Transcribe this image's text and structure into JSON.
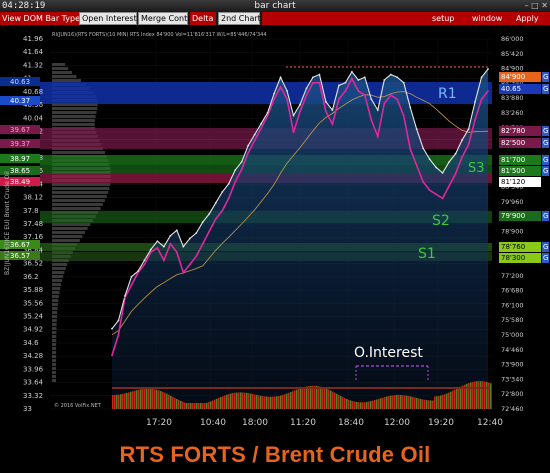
{
  "window": {
    "time": "04:28:19",
    "title": "bar chart",
    "controls": "– □ ✕"
  },
  "toolbar": {
    "view_dom": "View DOM",
    "bar_type": "Bar Type",
    "open_interest": "Open Interest",
    "merge_contr": "Merge Contr",
    "delta": "Delta",
    "second_chart": "2nd Chart",
    "setup": "setup",
    "window": "window",
    "apply": "Apply"
  },
  "chart": {
    "info_line": "RI(JUN16)(RTS FORTS)(10 MIN) RTS Index  84'900  Vol=11'816'317  W/L=85'446/74'344",
    "left_axis_title": "BZ(JUN16)(ICE EU) Brent Crude Oil",
    "copyright": "© 2016 VolFix.NET",
    "annotation_oi": "O.Interest",
    "levels": [
      {
        "name": "R1",
        "left_tag": "40.63",
        "left_tag2": "40.37",
        "right_tag": "84'900",
        "right_tag2": "40.65"
      },
      {
        "name": "",
        "left_tag": "39.67",
        "right_tag": "82'780"
      },
      {
        "name": "",
        "left_tag": "39.37",
        "right_tag": "82'500"
      },
      {
        "name": "S3",
        "left_tag": "38.97",
        "left_tag2": "38.65",
        "left_tag3": "38.49",
        "right_tag": "81'700",
        "right_tag2": "81'500",
        "right_tag3": "81'120"
      },
      {
        "name": "S2",
        "right_tag": "79'900"
      },
      {
        "name": "S1",
        "left_tag": "36.67",
        "left_tag2": "36.57",
        "right_tag": "78'760",
        "right_tag2": "78'300"
      }
    ],
    "g_marker": "G"
  },
  "chart_data": {
    "type": "line",
    "left_axis_ticks": [
      "41.96",
      "41.64",
      "41.32",
      "41",
      "40.68",
      "40.36",
      "40.04",
      "39.72",
      "39.4",
      "39.08",
      "38.76",
      "38.44",
      "38.12",
      "37.8",
      "37.48",
      "37.16",
      "36.84",
      "36.52",
      "36.2",
      "35.88",
      "35.56",
      "35.24",
      "34.92",
      "34.6",
      "34.28",
      "33.96",
      "33.64",
      "33.32",
      "33"
    ],
    "right_axis_ticks": [
      "86'000",
      "85'420",
      "84'900",
      "84'340",
      "83'880",
      "83'260",
      "82'780",
      "82'180",
      "81'700",
      "81'120",
      "80'540",
      "79'960",
      "79'440",
      "78'900",
      "78'300",
      "77'760",
      "77'200",
      "76'680",
      "76'100",
      "75'580",
      "75'000",
      "74'460",
      "73'900",
      "73'340",
      "72'800",
      "72'460"
    ],
    "x_ticks": [
      "17:20",
      "10:40",
      "18:00",
      "11:20",
      "18:40",
      "12:00",
      "19:20",
      "12:40"
    ],
    "series": [
      {
        "name": "RTS Index",
        "color": "#e6e6e6",
        "values": [
          75400,
          75700,
          76600,
          77300,
          77500,
          77900,
          78300,
          78600,
          78400,
          78800,
          79000,
          78400,
          78700,
          78900,
          79300,
          79600,
          80000,
          80400,
          80700,
          81200,
          81500,
          82100,
          82500,
          82900,
          83300,
          84000,
          84600,
          84100,
          83200,
          83600,
          84200,
          84600,
          84700,
          83700,
          83400,
          84300,
          84400,
          84800,
          84500,
          84600,
          83800,
          83400,
          84500,
          84700,
          84600,
          84400,
          83500,
          82700,
          82000,
          81600,
          81300,
          81100,
          81500,
          81800,
          82300,
          82700,
          83700,
          84600,
          84900
        ]
      },
      {
        "name": "Brent Crude Oil",
        "color": "#e0279c",
        "values": [
          34.3,
          34.8,
          35.7,
          36.0,
          36.3,
          36.5,
          36.8,
          36.9,
          36.6,
          37.0,
          36.8,
          36.3,
          36.5,
          36.7,
          37.0,
          37.3,
          37.6,
          37.8,
          38.1,
          38.5,
          38.8,
          39.2,
          39.5,
          39.8,
          40.1,
          40.5,
          40.8,
          40.5,
          39.7,
          40.2,
          40.6,
          40.9,
          40.9,
          40.2,
          39.9,
          40.5,
          40.7,
          41.0,
          40.7,
          40.6,
          40.0,
          39.6,
          40.4,
          40.6,
          40.5,
          40.1,
          39.3,
          38.9,
          38.5,
          38.3,
          38.2,
          38.1,
          38.4,
          38.7,
          39.1,
          39.4,
          40.0,
          40.5,
          40.7
        ]
      }
    ],
    "ylim_left": [
      33,
      41.96
    ],
    "ylim_right": [
      72460,
      86000
    ]
  }
}
